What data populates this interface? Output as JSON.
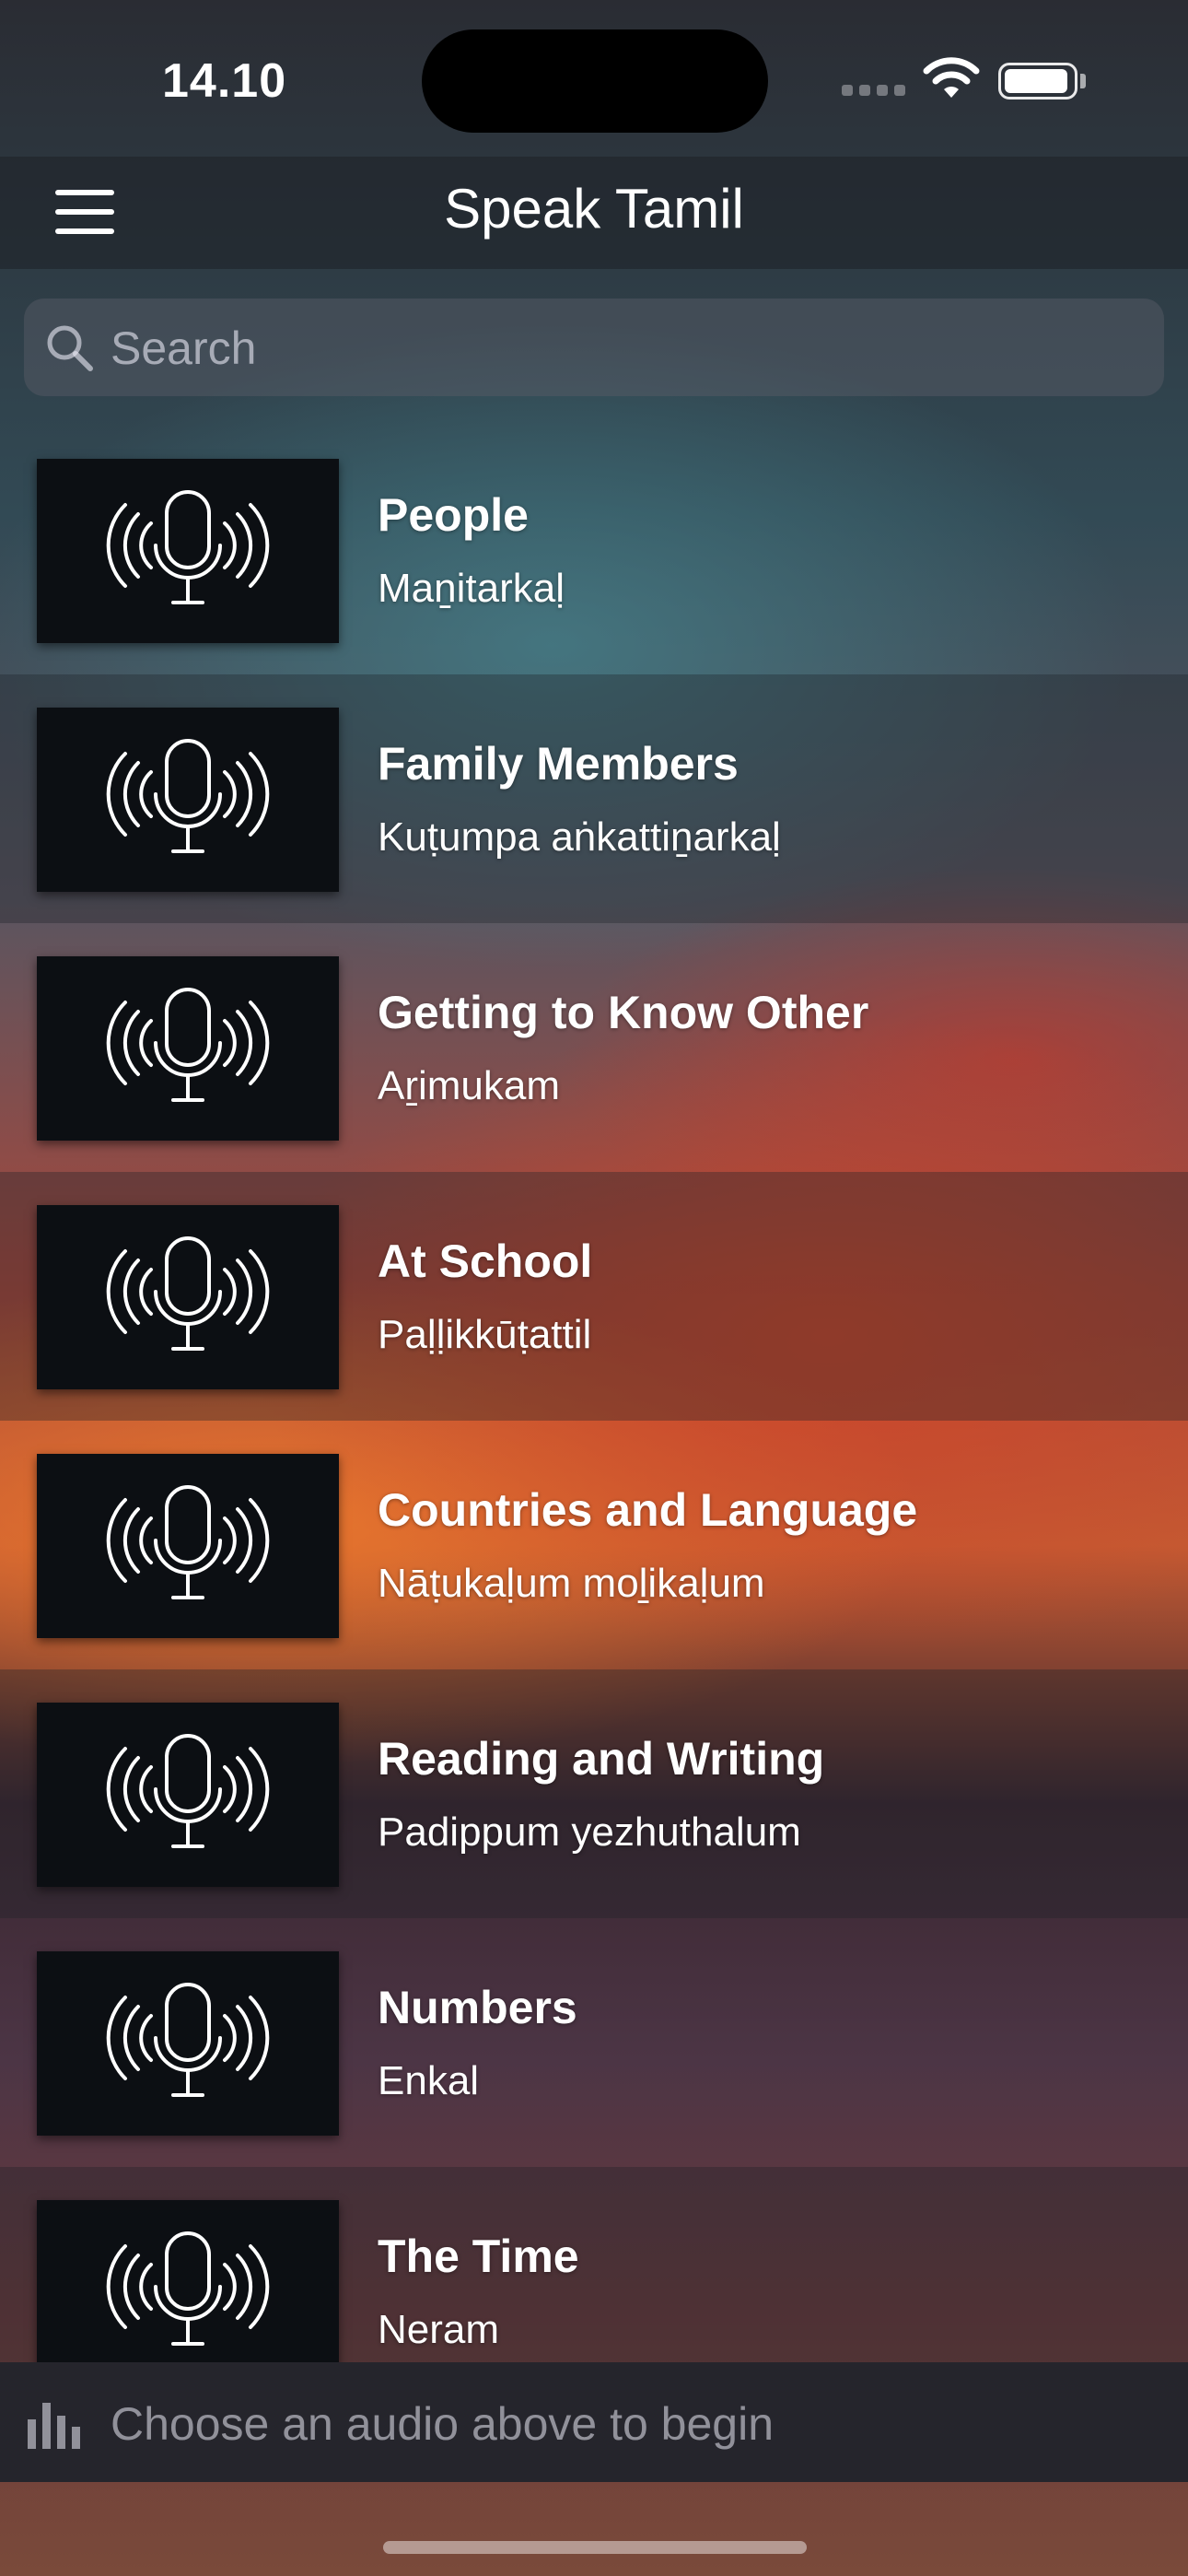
{
  "status_bar": {
    "time": "14.10",
    "battery_level": 0.95
  },
  "header": {
    "title": "Speak Tamil",
    "menu_icon": "hamburger-menu-icon"
  },
  "search": {
    "placeholder": "Search",
    "value": ""
  },
  "lessons": [
    {
      "title": "People",
      "subtitle": "Maṉitarkaḷ",
      "icon": "microphone-broadcast-icon"
    },
    {
      "title": "Family Members",
      "subtitle": "Kuṭumpa aṅkattiṉarkaḷ",
      "icon": "microphone-broadcast-icon"
    },
    {
      "title": "Getting to Know Other",
      "subtitle": "Aṟimukam",
      "icon": "microphone-broadcast-icon"
    },
    {
      "title": "At School",
      "subtitle": "Paḷḷikkūṭattil",
      "icon": "microphone-broadcast-icon"
    },
    {
      "title": "Countries and Language",
      "subtitle": "Nāṭukaḷum moḻikaḷum",
      "icon": "microphone-broadcast-icon"
    },
    {
      "title": "Reading and Writing",
      "subtitle": "Padippum yezhuthalum",
      "icon": "microphone-broadcast-icon"
    },
    {
      "title": "Numbers",
      "subtitle": "Enkal",
      "icon": "microphone-broadcast-icon"
    },
    {
      "title": "The Time",
      "subtitle": "Neram",
      "icon": "microphone-broadcast-icon"
    }
  ],
  "player": {
    "message": "Choose an audio above to begin",
    "icon": "audio-bars-icon"
  }
}
